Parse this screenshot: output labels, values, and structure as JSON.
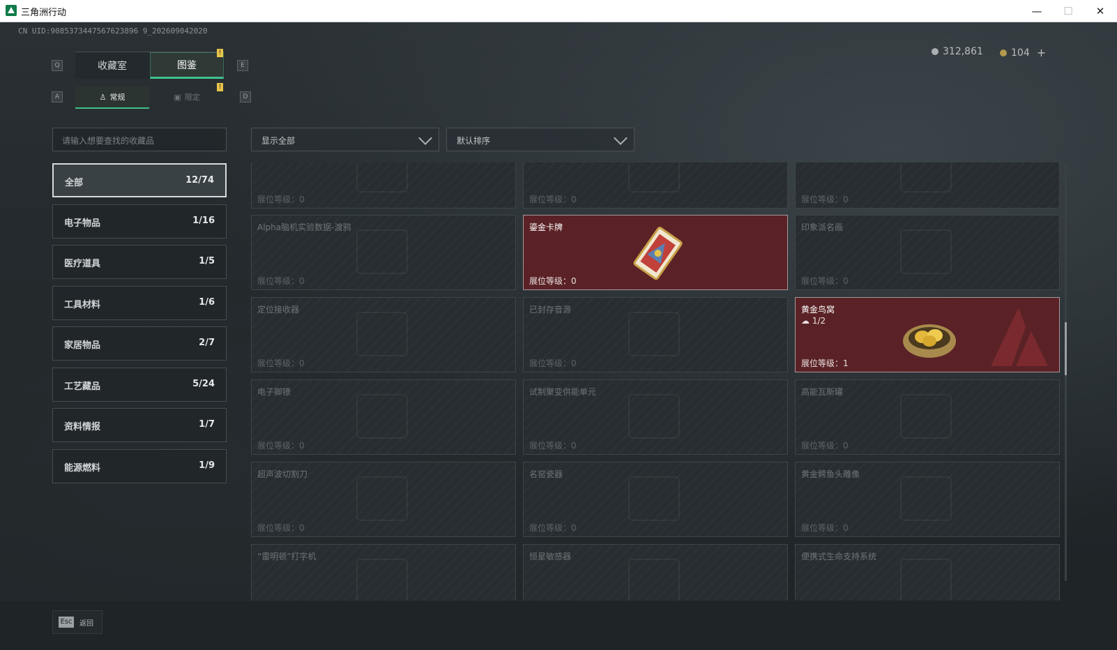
{
  "window": {
    "title": "三角洲行动",
    "minimize": "—",
    "maximize": "☐",
    "close": "✕"
  },
  "uid": "CN UID:9085373447567623896 9_202609042020",
  "currency": {
    "silver": "312,861",
    "gold": "104",
    "plus": "+"
  },
  "keys": {
    "prev_tab": "Q",
    "next_tab": "E",
    "prev_sub": "A",
    "next_sub": "D"
  },
  "tabs": [
    {
      "label": "收藏室"
    },
    {
      "label": "图鉴"
    }
  ],
  "subtabs": [
    {
      "label": "常规"
    },
    {
      "label": "限定"
    }
  ],
  "badge": "!",
  "search": {
    "placeholder": "请输入想要查找的收藏品"
  },
  "filters": {
    "show": "显示全部",
    "sort": "默认排序"
  },
  "categories": [
    {
      "name": "全部",
      "count": "12/74"
    },
    {
      "name": "电子物品",
      "count": "1/16"
    },
    {
      "name": "医疗道具",
      "count": "1/5"
    },
    {
      "name": "工具材料",
      "count": "1/6"
    },
    {
      "name": "家居物品",
      "count": "2/7"
    },
    {
      "name": "工艺藏品",
      "count": "5/24"
    },
    {
      "name": "资料情报",
      "count": "1/7"
    },
    {
      "name": "能源燃料",
      "count": "1/9"
    }
  ],
  "items": [
    {
      "name": "",
      "level": "展位等级：0",
      "owned": false
    },
    {
      "name": "",
      "level": "展位等级：0",
      "owned": false
    },
    {
      "name": "",
      "level": "展位等级：0",
      "owned": false
    },
    {
      "name": "Alpha脑机实验数据-渡鸦",
      "level": "展位等级：0",
      "owned": false
    },
    {
      "name": "鎏金卡牌",
      "level": "展位等级：0",
      "owned": true
    },
    {
      "name": "印象派名画",
      "level": "展位等级：0",
      "owned": false
    },
    {
      "name": "定位接收器",
      "level": "展位等级：0",
      "owned": false
    },
    {
      "name": "已封存音源",
      "level": "展位等级：0",
      "owned": false
    },
    {
      "name": "黄金鸟窝",
      "level": "展位等级：1",
      "owned": true,
      "qty": "1/2"
    },
    {
      "name": "电子脚镣",
      "level": "展位等级：0",
      "owned": false
    },
    {
      "name": "试制聚变供能单元",
      "level": "展位等级：0",
      "owned": false
    },
    {
      "name": "高能瓦斯罐",
      "level": "展位等级：0",
      "owned": false
    },
    {
      "name": "超声波切割刀",
      "level": "展位等级：0",
      "owned": false
    },
    {
      "name": "名窑瓷器",
      "level": "展位等级：0",
      "owned": false
    },
    {
      "name": "黄金鳄鱼头雕像",
      "level": "展位等级：0",
      "owned": false
    },
    {
      "name": "“雷明顿”打字机",
      "level": "",
      "owned": false
    },
    {
      "name": "恒星敏感器",
      "level": "",
      "owned": false
    },
    {
      "name": "便携式生命支持系统",
      "level": "",
      "owned": false
    }
  ],
  "footer": {
    "key": "Esc",
    "label": "返回"
  }
}
